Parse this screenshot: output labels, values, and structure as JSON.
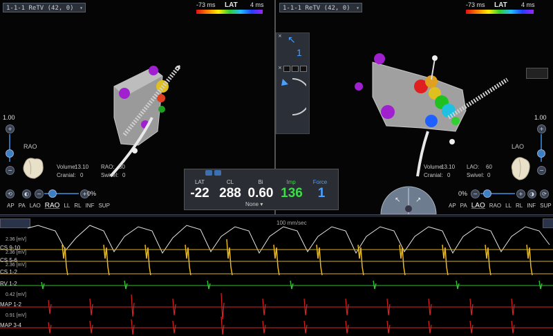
{
  "left_view": {
    "map_selector": "1-1-1 ReTV (42, 0)",
    "lat_label": "LAT",
    "lat_min": "-73 ms",
    "lat_max": "4 ms",
    "projection": "RAO",
    "zoom_top": "1.00",
    "zoom_bottom": "0%",
    "volume_label": "Volume:",
    "volume_value": "13.10",
    "cranial_label": "Cranial:",
    "cranial_value": "0",
    "rao_label": "RAO:",
    "rao_value": "30",
    "swivel_label": "Swivel:",
    "swivel_value": "0",
    "view_buttons": [
      "AP",
      "PA",
      "LAO",
      "RAO",
      "LL",
      "RL",
      "INF",
      "SUP"
    ],
    "active_view": "RAO"
  },
  "right_view": {
    "map_selector": "1-1-1 ReTV (42, 0)",
    "lat_label": "LAT",
    "lat_min": "-73 ms",
    "lat_max": "4 ms",
    "projection": "LAO",
    "zoom_top": "1.00",
    "zoom_bottom": "0%",
    "volume_label": "Volume:",
    "volume_value": "13.10",
    "cranial_label": "Cranial:",
    "cranial_value": "0",
    "lao_label": "LAO:",
    "lao_value": "60",
    "swivel_label": "Swivel:",
    "swivel_value": "0",
    "view_buttons": [
      "AP",
      "PA",
      "LAO",
      "RAO",
      "LL",
      "RL",
      "INF",
      "SUP"
    ],
    "active_view": "LAO"
  },
  "center_panel": {
    "counter": "1"
  },
  "metrics": {
    "items": [
      {
        "label": "LAT",
        "value": "-22",
        "color": "#ffffff"
      },
      {
        "label": "CL",
        "value": "288",
        "color": "#ffffff"
      },
      {
        "label": "Bi",
        "value": "0.60",
        "color": "#ffffff"
      },
      {
        "label": "Imp",
        "value": "136",
        "color": "#3ddc4a"
      },
      {
        "label": "Force",
        "value": "1",
        "color": "#4aa0ff"
      }
    ],
    "dropdown": "None"
  },
  "egm": {
    "sweep_label": "100 mm/sec",
    "channels": [
      {
        "name": "CS 9-10",
        "scale": "2.36 [mV]",
        "color": "#e8b820"
      },
      {
        "name": "CS 5-6",
        "scale": "2.36 [mV]",
        "color": "#e8b820"
      },
      {
        "name": "CS 1-2",
        "scale": "2.36 [mV]",
        "color": "#e8b820"
      },
      {
        "name": "RV 1-2",
        "scale": "0.42 [mV]",
        "color": "#30c030"
      },
      {
        "name": "MAP 1-2",
        "scale": "0.91 [mV]",
        "color": "#e02020"
      },
      {
        "name": "MAP 3-4",
        "scale": "",
        "color": "#e02020"
      }
    ]
  }
}
